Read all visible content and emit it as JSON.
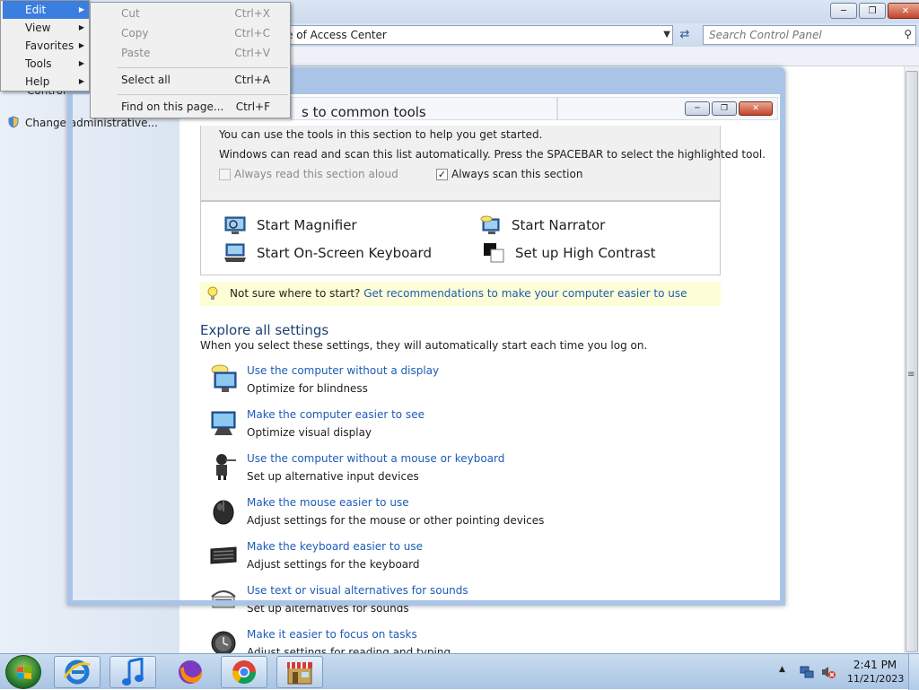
{
  "window": {
    "address_text": "e of Access Center",
    "search_placeholder": "Search Control Panel"
  },
  "left_pane": {
    "items": [
      "Control",
      "Change administrative..."
    ]
  },
  "menubar": {
    "items": [
      {
        "label": "Edit",
        "active": true
      },
      {
        "label": "View"
      },
      {
        "label": "Favorites"
      },
      {
        "label": "Tools"
      },
      {
        "label": "Help"
      }
    ]
  },
  "edit_menu": {
    "items": [
      {
        "label": "Cut",
        "shortcut": "Ctrl+X",
        "enabled": false
      },
      {
        "label": "Copy",
        "shortcut": "Ctrl+C",
        "enabled": false
      },
      {
        "label": "Paste",
        "shortcut": "Ctrl+V",
        "enabled": false
      },
      {
        "label": "Select all",
        "shortcut": "Ctrl+A",
        "enabled": true
      },
      {
        "label": "Find on this page...",
        "shortcut": "Ctrl+F",
        "enabled": true
      }
    ]
  },
  "quick_access": {
    "title": "s to common tools",
    "line1": "You can use the tools in this section to help you get started.",
    "line2": "Windows can read and scan this list automatically.  Press the SPACEBAR to select the highlighted tool.",
    "read_aloud_label": "Always read this section aloud",
    "read_aloud_checked": false,
    "scan_label": "Always scan this section",
    "scan_checked": true,
    "tools": [
      {
        "label": "Start Magnifier",
        "icon": "magnifier-icon"
      },
      {
        "label": "Start Narrator",
        "icon": "narrator-icon"
      },
      {
        "label": "Start On-Screen Keyboard",
        "icon": "keyboard-icon"
      },
      {
        "label": "Set up High Contrast",
        "icon": "contrast-icon"
      }
    ]
  },
  "hint": {
    "text": "Not sure where to start?",
    "link": "Get recommendations to make your computer easier to use"
  },
  "explore": {
    "title": "Explore all settings",
    "subtitle": "When you select these settings, they will automatically start each time you log on.",
    "settings": [
      {
        "link": "Use the computer without a display",
        "desc": "Optimize for blindness"
      },
      {
        "link": "Make the computer easier to see",
        "desc": "Optimize visual display"
      },
      {
        "link": "Use the computer without a mouse or keyboard",
        "desc": "Set up alternative input devices"
      },
      {
        "link": "Make the mouse easier to use",
        "desc": "Adjust settings for the mouse or other pointing devices"
      },
      {
        "link": "Make the keyboard easier to use",
        "desc": "Adjust settings for the keyboard"
      },
      {
        "link": "Use text or visual alternatives for sounds",
        "desc": "Set up alternatives for sounds"
      },
      {
        "link": "Make it easier to focus on tasks",
        "desc": "Adjust settings for reading and typing"
      }
    ]
  },
  "taskbar": {
    "apps": [
      "Internet Explorer",
      "iTunes",
      "Firefox",
      "Chrome",
      "Store"
    ],
    "time": "2:41 PM",
    "date": "11/21/2023"
  },
  "colors": {
    "link": "#1e5bb8",
    "heading": "#1e3f75",
    "menu_highlight": "#3a7ee0",
    "hint_bg": "#fefed6"
  }
}
